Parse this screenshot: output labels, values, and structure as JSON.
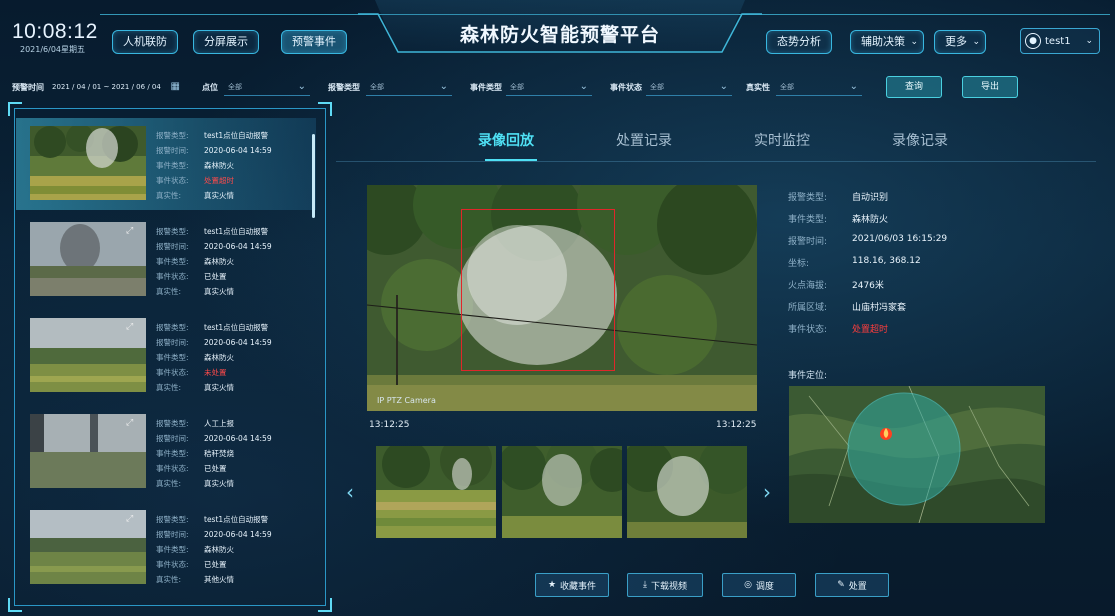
{
  "header": {
    "clock": "10:08:12",
    "date": "2021/6/04星期五",
    "title": "森林防火智能预警平台",
    "left_nav": [
      "人机联防",
      "分屏展示",
      "预警事件"
    ],
    "right_nav": [
      "态势分析",
      "辅助决策",
      "更多"
    ],
    "user": "test1"
  },
  "filters": {
    "time_label": "预警时间",
    "time_value": "2021 / 04 / 01 ~ 2021 / 06 / 04",
    "point_label": "点位",
    "point_value": "全部",
    "alarm_type_label": "报警类型",
    "alarm_type_value": "全部",
    "event_type_label": "事件类型",
    "event_type_value": "全部",
    "event_status_label": "事件状态",
    "event_status_value": "全部",
    "truth_label": "真实性",
    "truth_value": "全部",
    "query_button": "查询",
    "export_button": "导出"
  },
  "list_keys": {
    "alarm_type": "报警类型:",
    "alarm_time": "报警时间:",
    "event_type": "事件类型:",
    "event_status": "事件状态:",
    "truth": "真实性:"
  },
  "events": [
    {
      "alarm_type": "test1点位自动报警",
      "alarm_time": "2020-06-04 14:59",
      "event_type": "森林防火",
      "event_status": "处置超时",
      "truth": "真实火情"
    },
    {
      "alarm_type": "test1点位自动报警",
      "alarm_time": "2020-06-04 14:59",
      "event_type": "森林防火",
      "event_status": "已处置",
      "truth": "真实火情"
    },
    {
      "alarm_type": "test1点位自动报警",
      "alarm_time": "2020-06-04 14:59",
      "event_type": "森林防火",
      "event_status": "未处置",
      "truth": "真实火情"
    },
    {
      "alarm_type": "人工上报",
      "alarm_time": "2020-06-04 14:59",
      "event_type": "秸秆焚烧",
      "event_status": "已处置",
      "truth": "真实火情"
    },
    {
      "alarm_type": "test1点位自动报警",
      "alarm_time": "2020-06-04 14:59",
      "event_type": "森林防火",
      "event_status": "已处置",
      "truth": "其他火情"
    }
  ],
  "tabs": [
    "录像回放",
    "处置记录",
    "实时监控",
    "录像记录"
  ],
  "video": {
    "caption": "IP PTZ Camera",
    "time_start": "13:12:25",
    "time_end": "13:12:25"
  },
  "detail": {
    "rows": [
      {
        "k": "报警类型:",
        "v": "自动识别"
      },
      {
        "k": "事件类型:",
        "v": "森林防火"
      },
      {
        "k": "报警时间:",
        "v": "2021/06/03 16:15:29"
      },
      {
        "k": "坐标:",
        "v": "118.16, 368.12"
      },
      {
        "k": "火点海拔:",
        "v": "2476米"
      },
      {
        "k": "所属区域:",
        "v": "山庙村冯家套"
      },
      {
        "k": "事件状态:",
        "v": "处置超时"
      }
    ],
    "location_label": "事件定位:"
  },
  "actions": [
    "收藏事件",
    "下载视频",
    "调度",
    "处置"
  ],
  "colors": {
    "accent": "#4fe0f4",
    "alert": "#ff3d3d",
    "border": "#2a97c6"
  }
}
